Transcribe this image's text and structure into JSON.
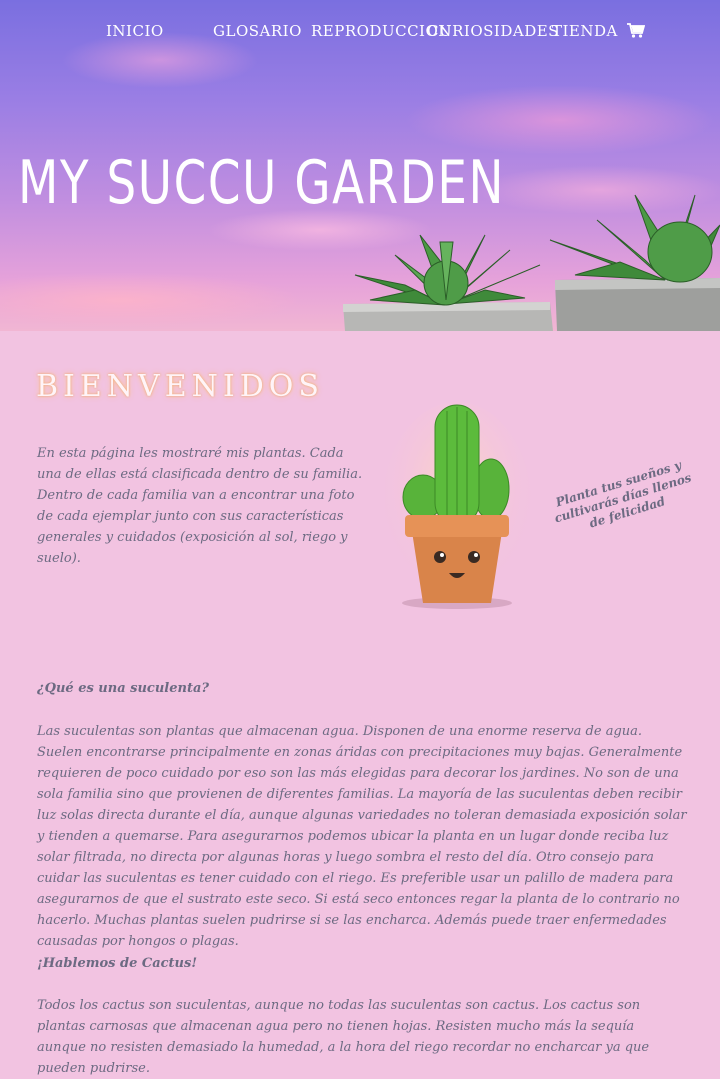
{
  "nav": {
    "items": [
      {
        "label": "INICIO"
      },
      {
        "label": "GLOSARIO"
      },
      {
        "label": "REPRODUCCION"
      },
      {
        "label": "CURIOSIDADES"
      },
      {
        "label": "TIENDA"
      }
    ],
    "cart_icon": "shopping-cart-icon"
  },
  "hero": {
    "title": "MY SUCCU GARDEN"
  },
  "welcome": {
    "heading": "BIENVENIDOS",
    "intro": "En esta página les mostraré mis plantas. Cada una de ellas está clasificada dentro de su familia. Dentro de cada familia van a encontrar una foto de cada ejemplar junto con sus características generales y cuidados (exposición al sol, riego y suelo).",
    "quote": "Planta tus sueños y cultivarás días llenos de felicidad"
  },
  "sections": [
    {
      "title": "¿Qué es una suculenta?",
      "body": "Las suculentas son plantas que almacenan agua. Disponen de una enorme reserva de agua. Suelen encontrarse principalmente en zonas áridas con precipitaciones muy bajas. Generalmente requieren de poco cuidado por eso son las más elegidas para decorar los jardines. No son de una sola familia sino que provienen de diferentes familias. La mayoría de las suculentas deben recibir luz solas directa durante el día, aunque algunas variedades no toleran demasiada exposición solar y tienden a quemarse. Para asegurarnos podemos ubicar la planta en un lugar donde reciba luz solar filtrada, no directa por algunas horas y luego sombra el resto del día. Otro consejo para cuidar las suculentas es tener cuidado con el riego. Es preferible usar un palillo de madera para asegurarnos de que el sustrato este seco. Si está seco entonces regar la planta de lo contrario no hacerlo. Muchas plantas suelen pudrirse si se las encharca. Además puede traer enfermedades causadas por hongos o plagas."
    },
    {
      "title": "¡Hablemos de Cactus!",
      "body": "Todos los cactus son suculentas, aunque no todas las suculentas son cactus. Los cactus son plantas carnosas que almacenan agua pero no tienen hojas. Resisten mucho más la sequía aunque no resisten demasiado la humedad, a la hora del riego recordar no encharcar ya que pueden pudrirse."
    }
  ],
  "colors": {
    "page_background": "#f2c3e1",
    "text": "#6c6a82",
    "nav_text": "#ffffff"
  }
}
